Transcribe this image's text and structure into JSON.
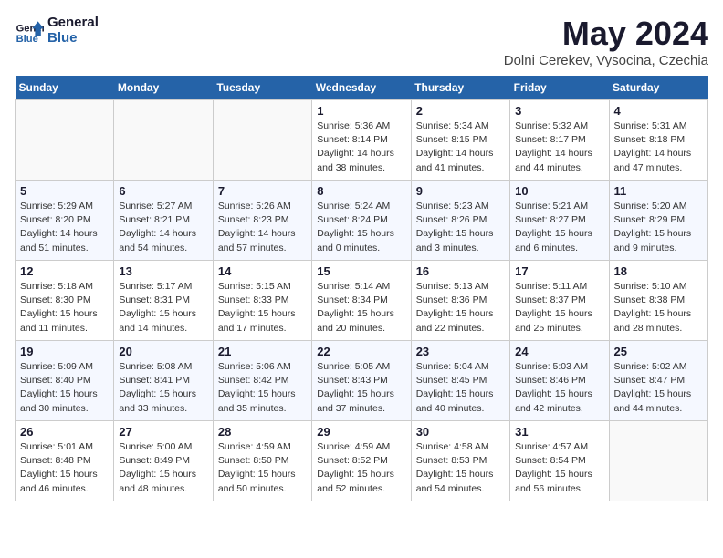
{
  "header": {
    "logo_line1": "General",
    "logo_line2": "Blue",
    "month_title": "May 2024",
    "location": "Dolni Cerekev, Vysocina, Czechia"
  },
  "weekdays": [
    "Sunday",
    "Monday",
    "Tuesday",
    "Wednesday",
    "Thursday",
    "Friday",
    "Saturday"
  ],
  "weeks": [
    [
      {
        "day": "",
        "info": ""
      },
      {
        "day": "",
        "info": ""
      },
      {
        "day": "",
        "info": ""
      },
      {
        "day": "1",
        "info": "Sunrise: 5:36 AM\nSunset: 8:14 PM\nDaylight: 14 hours\nand 38 minutes."
      },
      {
        "day": "2",
        "info": "Sunrise: 5:34 AM\nSunset: 8:15 PM\nDaylight: 14 hours\nand 41 minutes."
      },
      {
        "day": "3",
        "info": "Sunrise: 5:32 AM\nSunset: 8:17 PM\nDaylight: 14 hours\nand 44 minutes."
      },
      {
        "day": "4",
        "info": "Sunrise: 5:31 AM\nSunset: 8:18 PM\nDaylight: 14 hours\nand 47 minutes."
      }
    ],
    [
      {
        "day": "5",
        "info": "Sunrise: 5:29 AM\nSunset: 8:20 PM\nDaylight: 14 hours\nand 51 minutes."
      },
      {
        "day": "6",
        "info": "Sunrise: 5:27 AM\nSunset: 8:21 PM\nDaylight: 14 hours\nand 54 minutes."
      },
      {
        "day": "7",
        "info": "Sunrise: 5:26 AM\nSunset: 8:23 PM\nDaylight: 14 hours\nand 57 minutes."
      },
      {
        "day": "8",
        "info": "Sunrise: 5:24 AM\nSunset: 8:24 PM\nDaylight: 15 hours\nand 0 minutes."
      },
      {
        "day": "9",
        "info": "Sunrise: 5:23 AM\nSunset: 8:26 PM\nDaylight: 15 hours\nand 3 minutes."
      },
      {
        "day": "10",
        "info": "Sunrise: 5:21 AM\nSunset: 8:27 PM\nDaylight: 15 hours\nand 6 minutes."
      },
      {
        "day": "11",
        "info": "Sunrise: 5:20 AM\nSunset: 8:29 PM\nDaylight: 15 hours\nand 9 minutes."
      }
    ],
    [
      {
        "day": "12",
        "info": "Sunrise: 5:18 AM\nSunset: 8:30 PM\nDaylight: 15 hours\nand 11 minutes."
      },
      {
        "day": "13",
        "info": "Sunrise: 5:17 AM\nSunset: 8:31 PM\nDaylight: 15 hours\nand 14 minutes."
      },
      {
        "day": "14",
        "info": "Sunrise: 5:15 AM\nSunset: 8:33 PM\nDaylight: 15 hours\nand 17 minutes."
      },
      {
        "day": "15",
        "info": "Sunrise: 5:14 AM\nSunset: 8:34 PM\nDaylight: 15 hours\nand 20 minutes."
      },
      {
        "day": "16",
        "info": "Sunrise: 5:13 AM\nSunset: 8:36 PM\nDaylight: 15 hours\nand 22 minutes."
      },
      {
        "day": "17",
        "info": "Sunrise: 5:11 AM\nSunset: 8:37 PM\nDaylight: 15 hours\nand 25 minutes."
      },
      {
        "day": "18",
        "info": "Sunrise: 5:10 AM\nSunset: 8:38 PM\nDaylight: 15 hours\nand 28 minutes."
      }
    ],
    [
      {
        "day": "19",
        "info": "Sunrise: 5:09 AM\nSunset: 8:40 PM\nDaylight: 15 hours\nand 30 minutes."
      },
      {
        "day": "20",
        "info": "Sunrise: 5:08 AM\nSunset: 8:41 PM\nDaylight: 15 hours\nand 33 minutes."
      },
      {
        "day": "21",
        "info": "Sunrise: 5:06 AM\nSunset: 8:42 PM\nDaylight: 15 hours\nand 35 minutes."
      },
      {
        "day": "22",
        "info": "Sunrise: 5:05 AM\nSunset: 8:43 PM\nDaylight: 15 hours\nand 37 minutes."
      },
      {
        "day": "23",
        "info": "Sunrise: 5:04 AM\nSunset: 8:45 PM\nDaylight: 15 hours\nand 40 minutes."
      },
      {
        "day": "24",
        "info": "Sunrise: 5:03 AM\nSunset: 8:46 PM\nDaylight: 15 hours\nand 42 minutes."
      },
      {
        "day": "25",
        "info": "Sunrise: 5:02 AM\nSunset: 8:47 PM\nDaylight: 15 hours\nand 44 minutes."
      }
    ],
    [
      {
        "day": "26",
        "info": "Sunrise: 5:01 AM\nSunset: 8:48 PM\nDaylight: 15 hours\nand 46 minutes."
      },
      {
        "day": "27",
        "info": "Sunrise: 5:00 AM\nSunset: 8:49 PM\nDaylight: 15 hours\nand 48 minutes."
      },
      {
        "day": "28",
        "info": "Sunrise: 4:59 AM\nSunset: 8:50 PM\nDaylight: 15 hours\nand 50 minutes."
      },
      {
        "day": "29",
        "info": "Sunrise: 4:59 AM\nSunset: 8:52 PM\nDaylight: 15 hours\nand 52 minutes."
      },
      {
        "day": "30",
        "info": "Sunrise: 4:58 AM\nSunset: 8:53 PM\nDaylight: 15 hours\nand 54 minutes."
      },
      {
        "day": "31",
        "info": "Sunrise: 4:57 AM\nSunset: 8:54 PM\nDaylight: 15 hours\nand 56 minutes."
      },
      {
        "day": "",
        "info": ""
      }
    ]
  ]
}
